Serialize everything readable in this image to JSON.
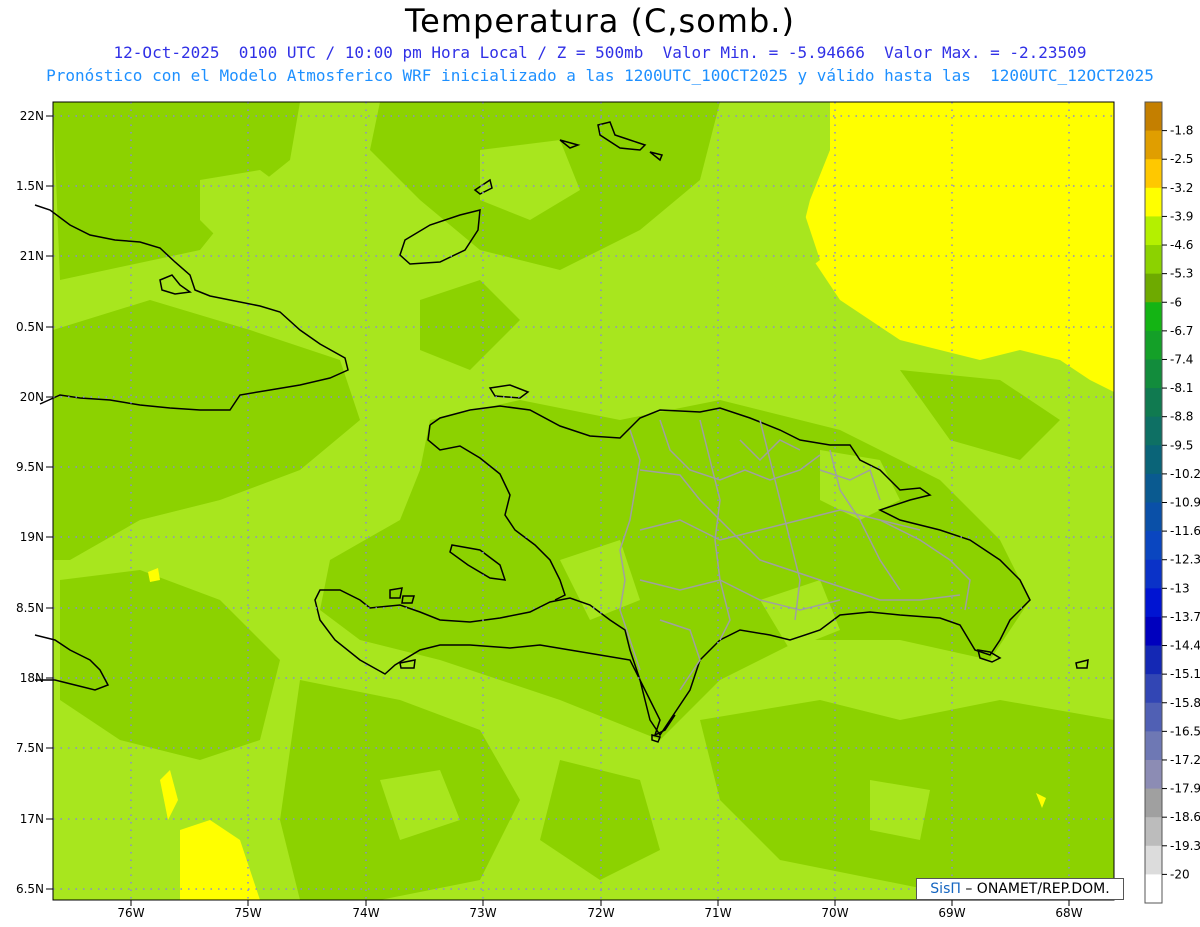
{
  "header": {
    "title": "Temperatura (C,somb.)",
    "line1": "12-Oct-2025  0100 UTC / 10:00 pm Hora Local / Z = 500mb  Valor Min. = -5.94666  Valor Max. = -2.23509",
    "line2": "Pronóstico con el Modelo Atmosferico WRF inicializado a las 1200UTC_10OCT2025 y válido hasta las  1200UTC_12OCT2025"
  },
  "axes": {
    "lat_labels": [
      "22N",
      "1.5N",
      "21N",
      "0.5N",
      "20N",
      "9.5N",
      "19N",
      "8.5N",
      "18N",
      "7.5N",
      "17N",
      "6.5N"
    ],
    "lon_labels": [
      "76W",
      "75W",
      "74W",
      "73W",
      "72W",
      "71W",
      "70W",
      "69W",
      "68W"
    ]
  },
  "colorbar": {
    "labels": [
      "-1.8",
      "-2.5",
      "-3.2",
      "-3.9",
      "-4.6",
      "-5.3",
      "-6",
      "-6.7",
      "-7.4",
      "-8.1",
      "-8.8",
      "-9.5",
      "-10.2",
      "-10.9",
      "-11.6",
      "-12.3",
      "-13",
      "-13.7",
      "-14.4",
      "-15.1",
      "-15.8",
      "-16.5",
      "-17.2",
      "-17.9",
      "-18.6",
      "-19.3",
      "-20"
    ],
    "colors": [
      "#c47f00",
      "#e09e00",
      "#ffc800",
      "#ffff00",
      "#b4f000",
      "#8cd200",
      "#6eaa00",
      "#14b414",
      "#14a028",
      "#128c3c",
      "#107a50",
      "#0e7064",
      "#0a6478",
      "#0a5a90",
      "#0a50a8",
      "#0a46c0",
      "#0a32c8",
      "#0014d2",
      "#0000be",
      "#1428b4",
      "#3246b4",
      "#5060b4",
      "#6e78b4",
      "#8c8cb4",
      "#a0a0a0",
      "#bcbcbc",
      "#dcdcdc",
      "#ffffff"
    ]
  },
  "map_colors": {
    "bright_green": "#a8e61e",
    "mid_green": "#8cd200",
    "dark_green": "#6eaa00",
    "yellow": "#ffff00",
    "coast": "#000000",
    "provinces": "#a0a0a0",
    "grid": "#8a8ad0"
  },
  "credit": {
    "brand": "SisΠ",
    "text": " – ONAMET/REP.DOM."
  }
}
